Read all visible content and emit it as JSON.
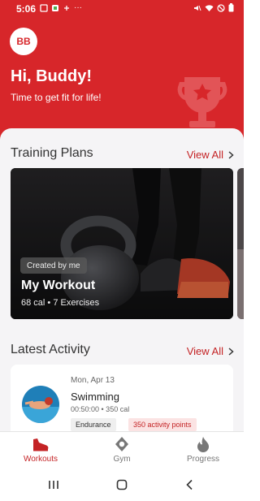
{
  "status_bar": {
    "time": "5:06",
    "more": "···"
  },
  "header": {
    "avatar_initials": "BB",
    "greeting": "Hi, Buddy!",
    "tagline": "Time to get fit for life!",
    "trophy_icon": "trophy-icon"
  },
  "training_plans": {
    "title": "Training Plans",
    "view_all_label": "View All",
    "cards": [
      {
        "badge": "Created by me",
        "name": "My Workout",
        "meta": "68 cal • 7 Exercises"
      }
    ]
  },
  "latest_activity": {
    "title": "Latest Activity",
    "view_all_label": "View All",
    "items": [
      {
        "date": "Mon, Apr 13",
        "name": "Swimming",
        "meta": "00:50:00 • 350 cal",
        "tags": [
          "Endurance",
          "350 activity points"
        ]
      }
    ]
  },
  "bottom_nav": {
    "items": [
      {
        "label": "Workouts",
        "icon": "sneaker-icon",
        "active": true
      },
      {
        "label": "Gym",
        "icon": "location-pin-icon",
        "active": false
      },
      {
        "label": "Progress",
        "icon": "flame-icon",
        "active": false
      }
    ]
  },
  "colors": {
    "brand": "#d7262a",
    "accent_text": "#c42325",
    "active_nav": "#c42325",
    "inactive_nav": "#777777",
    "sheet_bg": "#f5f4f6"
  }
}
